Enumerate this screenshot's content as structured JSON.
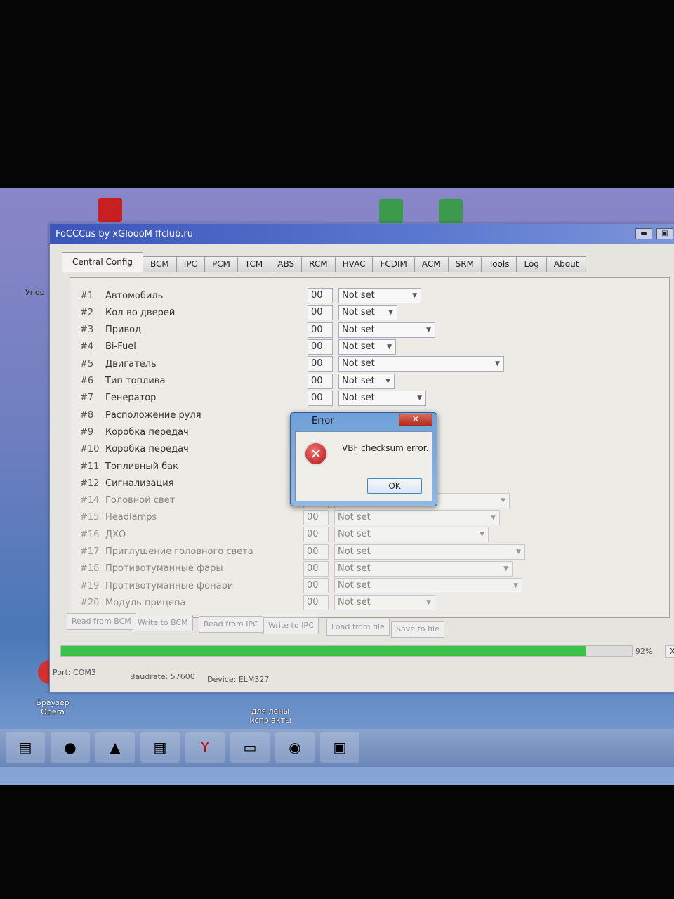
{
  "window": {
    "title": "FoCCCus by xGloooM ffclub.ru",
    "minimize": "▬",
    "maximize": "▣"
  },
  "tabs": [
    "Central Config",
    "BCM",
    "IPC",
    "PCM",
    "TCM",
    "ABS",
    "RCM",
    "HVAC",
    "FCDIM",
    "ACM",
    "SRM",
    "Tools",
    "Log",
    "About"
  ],
  "rows": [
    {
      "num": "#1",
      "label": "Автомобиль",
      "hex": "00",
      "value": "Not set"
    },
    {
      "num": "#2",
      "label": "Кол-во дверей",
      "hex": "00",
      "value": "Not set"
    },
    {
      "num": "#3",
      "label": "Привод",
      "hex": "00",
      "value": "Not set"
    },
    {
      "num": "#4",
      "label": "Bi-Fuel",
      "hex": "00",
      "value": "Not set"
    },
    {
      "num": "#5",
      "label": "Двигатель",
      "hex": "00",
      "value": "Not set"
    },
    {
      "num": "#6",
      "label": "Тип топлива",
      "hex": "00",
      "value": "Not set"
    },
    {
      "num": "#7",
      "label": "Генератор",
      "hex": "00",
      "value": "Not set"
    },
    {
      "num": "#8",
      "label": "Расположение руля",
      "hex": "",
      "value": ""
    },
    {
      "num": "#9",
      "label": "Коробка передач",
      "hex": "",
      "value": ""
    },
    {
      "num": "#10",
      "label": "Коробка передач",
      "hex": "",
      "value": ""
    },
    {
      "num": "#11",
      "label": "Топливный бак",
      "hex": "",
      "value": ""
    },
    {
      "num": "#12",
      "label": "Сигнализация",
      "hex": "",
      "value": ""
    },
    {
      "num": "#14",
      "label": "Головной свет",
      "hex": "00",
      "value": "Not set"
    },
    {
      "num": "#15",
      "label": "Headlamps",
      "hex": "00",
      "value": "Not set"
    },
    {
      "num": "#16",
      "label": "ДХО",
      "hex": "00",
      "value": "Not set"
    },
    {
      "num": "#17",
      "label": "Приглушение головного света",
      "hex": "00",
      "value": "Not set"
    },
    {
      "num": "#18",
      "label": "Противотуманные фары",
      "hex": "00",
      "value": "Not set"
    },
    {
      "num": "#19",
      "label": "Противотуманные фонари",
      "hex": "00",
      "value": "Not set"
    },
    {
      "num": "#20",
      "label": "Модуль прицепа",
      "hex": "00",
      "value": "Not set"
    }
  ],
  "buttons": {
    "read_bcm": "Read from BCM",
    "write_bcm": "Write to BCM",
    "read_ipc": "Read from IPC",
    "write_ipc": "Write to IPC",
    "load_file": "Load from file",
    "save_file": "Save to file"
  },
  "progress": {
    "percent": 92,
    "label": "92%",
    "cancel": "X"
  },
  "status": {
    "port": "Port: COM3",
    "baudrate": "Baudrate: 57600",
    "device": "Device: ELM327"
  },
  "dialog": {
    "title": "Error",
    "message": "VBF checksum error.",
    "ok": "OK",
    "close": "✕"
  },
  "desktop": {
    "icon1": "Упор",
    "opera": "Браузер Opera",
    "folder": "для лены испр акты"
  },
  "colors": {
    "progress": "#3cc24a",
    "titlebar": "#3b55b8"
  }
}
